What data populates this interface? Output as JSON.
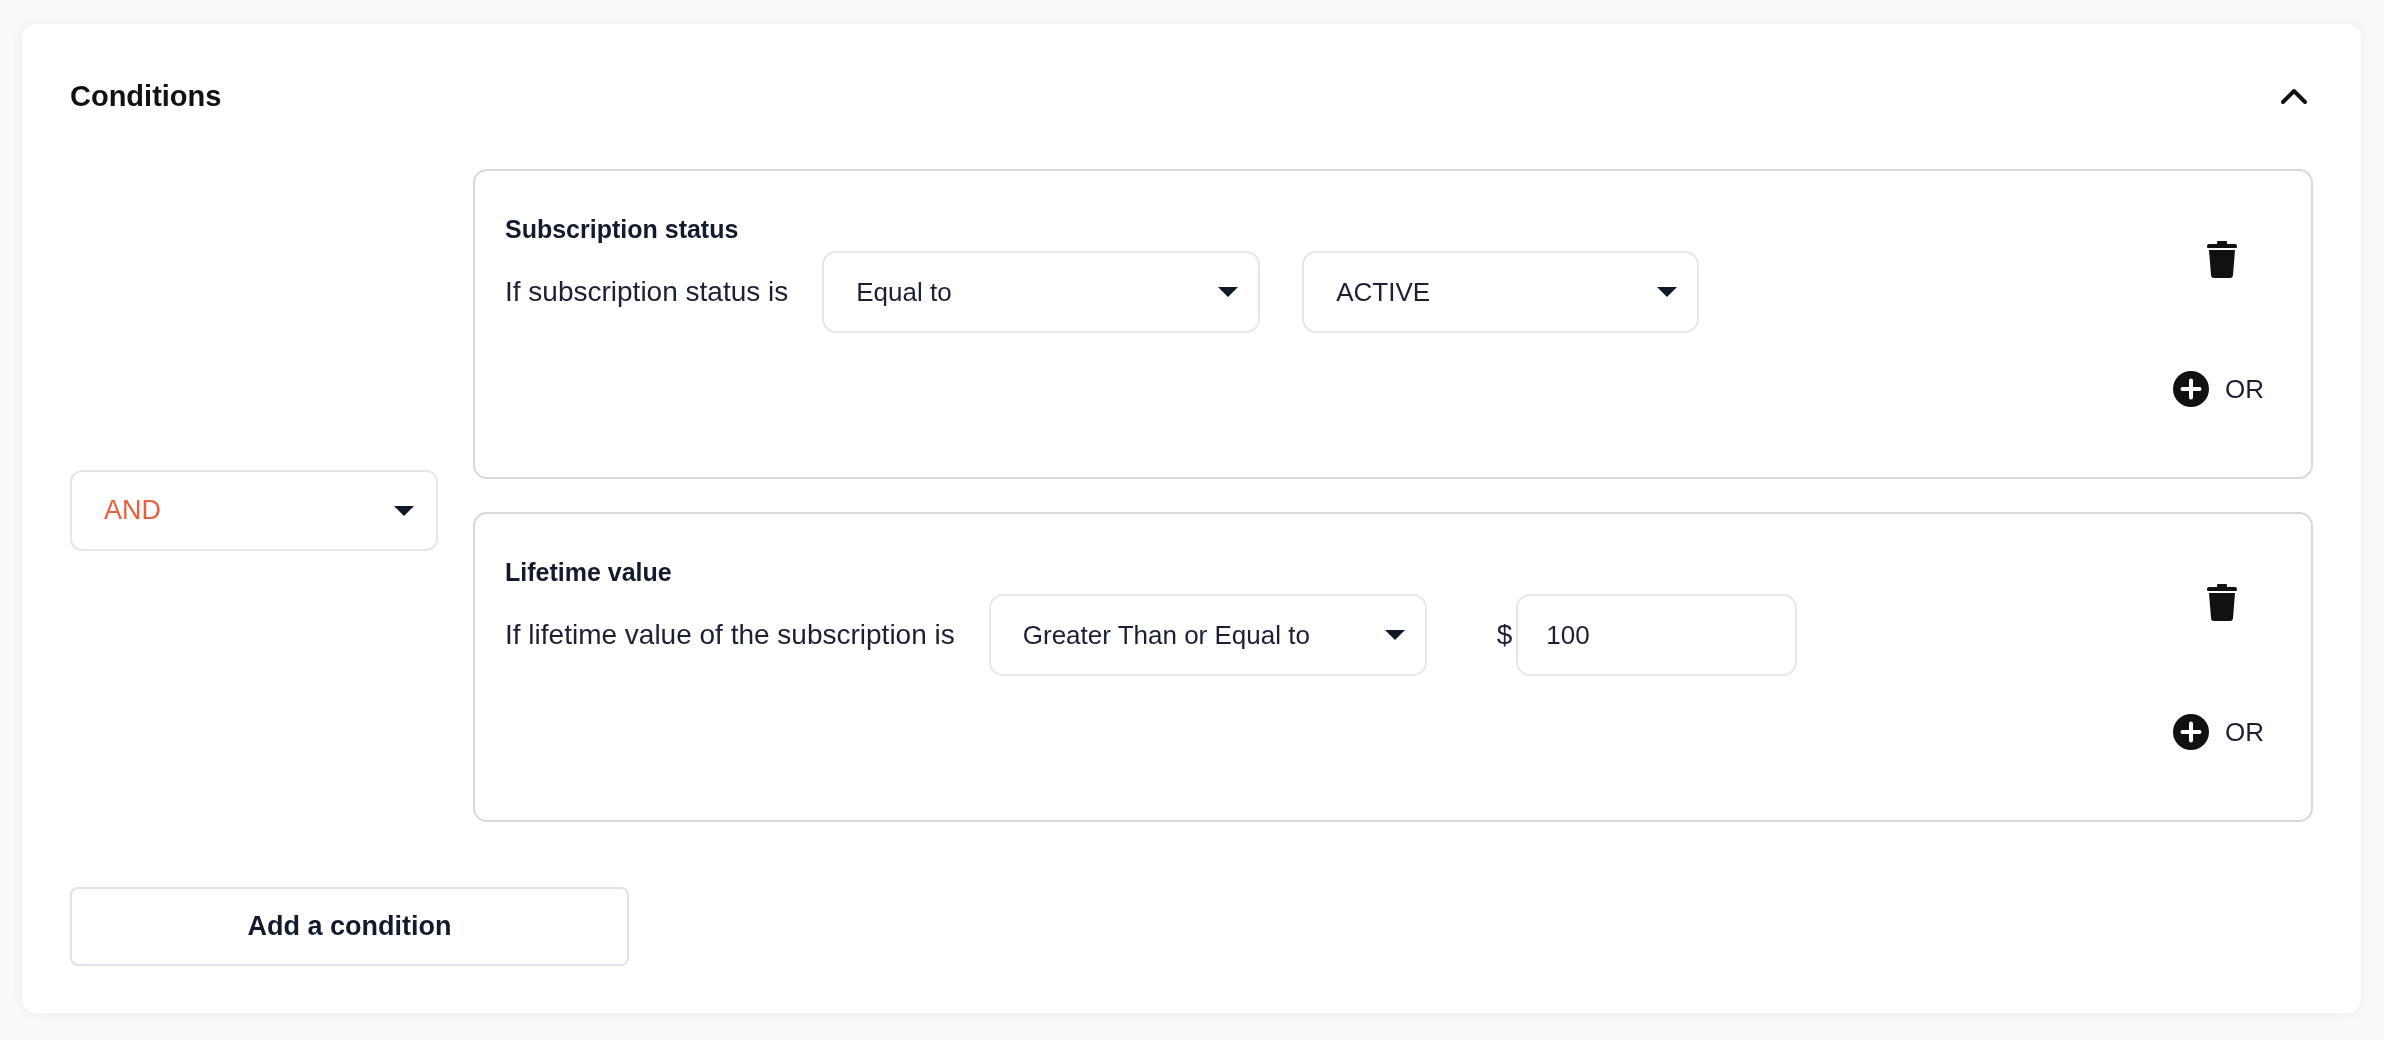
{
  "panel": {
    "title": "Conditions",
    "expanded": true
  },
  "logic_operator": {
    "value": "AND"
  },
  "conditions": [
    {
      "title": "Subscription status",
      "label": "If subscription status is",
      "fields": [
        {
          "kind": "dropdown",
          "value": "Equal to"
        },
        {
          "kind": "dropdown",
          "value": "ACTIVE"
        }
      ],
      "or_button": "OR"
    },
    {
      "title": "Lifetime value",
      "label": "If lifetime value of the subscription is",
      "fields": [
        {
          "kind": "dropdown",
          "value": "Greater Than or Equal to"
        },
        {
          "kind": "currency",
          "prefix": "$",
          "value": "100"
        }
      ],
      "or_button": "OR"
    }
  ],
  "add_button": "Add a condition"
}
